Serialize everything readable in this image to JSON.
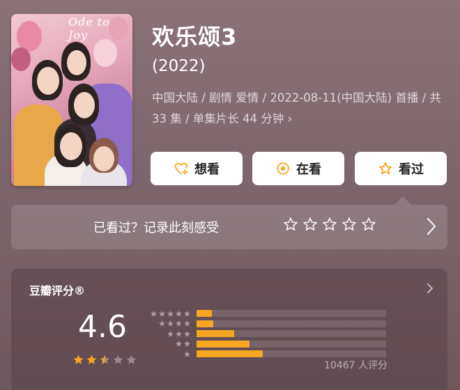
{
  "show": {
    "title": "欢乐颂3",
    "year": "(2022)",
    "meta": "中国大陆 / 剧情 爱情 / 2022-08-11(中国大陆) 首播 / 共 33 集 / 单集片长 44 分钟 ›",
    "poster_title": "Ode to Joy"
  },
  "actions": [
    {
      "label": "想看",
      "icon": "heart-plus-icon"
    },
    {
      "label": "在看",
      "icon": "target-circle-icon"
    },
    {
      "label": "看过",
      "icon": "star-outline-icon"
    }
  ],
  "record": {
    "prompt": "已看过？记录此刻感受",
    "star_count": 5
  },
  "rating": {
    "label": "豆瓣评分®",
    "score": "4.6",
    "stars": 2.5,
    "count_text": "10467 人评分",
    "distribution": [
      {
        "stars": 5,
        "fraction": 0.08
      },
      {
        "stars": 4,
        "fraction": 0.09
      },
      {
        "stars": 3,
        "fraction": 0.2
      },
      {
        "stars": 2,
        "fraction": 0.28
      },
      {
        "stars": 1,
        "fraction": 0.35
      }
    ]
  },
  "colors": {
    "accent": "#f5a623",
    "background": "#7d666c"
  }
}
